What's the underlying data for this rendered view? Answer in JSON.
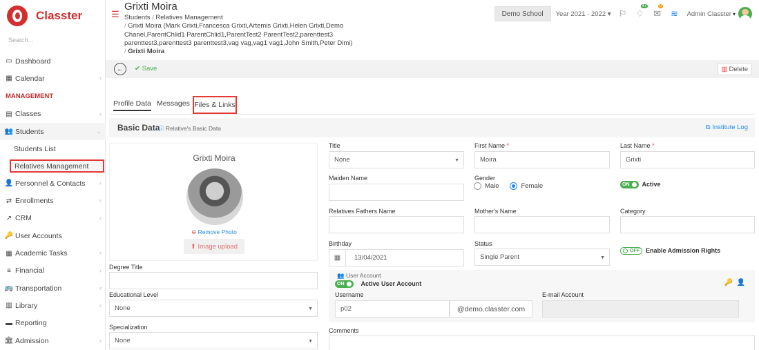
{
  "brand": {
    "name": "Classter"
  },
  "sidebar": {
    "search_placeholder": "Search...",
    "items": [
      {
        "label": "Dashboard",
        "icon": "monitor-icon"
      },
      {
        "label": "Calendar",
        "icon": "calendar-icon"
      }
    ],
    "section_label": "MANAGEMENT",
    "management": [
      {
        "label": "Classes",
        "icon": "classes-icon"
      },
      {
        "label": "Students",
        "icon": "students-icon"
      }
    ],
    "students_sub": [
      "Students List",
      "Relatives Management"
    ],
    "more": [
      {
        "label": "Personnel & Contacts",
        "icon": "personnel-icon"
      },
      {
        "label": "Enrollments",
        "icon": "enrollments-icon"
      },
      {
        "label": "CRM",
        "icon": "crm-icon"
      },
      {
        "label": "User Accounts",
        "icon": "key-icon"
      },
      {
        "label": "Academic Tasks",
        "icon": "tasks-icon"
      },
      {
        "label": "Financial",
        "icon": "money-icon"
      },
      {
        "label": "Transportation",
        "icon": "bus-icon"
      },
      {
        "label": "Library",
        "icon": "library-icon"
      },
      {
        "label": "Reporting",
        "icon": "printer-icon"
      },
      {
        "label": "Admission",
        "icon": "admission-icon"
      }
    ]
  },
  "header": {
    "title": "Grixti Moira",
    "crumb1": "Students",
    "crumb2": "Relatives Management",
    "crumb3": "Grixti Moira (Mark Grixti,Francesca Grixti,Artemis Grixti,Helen Grixti,Demo Chanel,ParentChlid1 ParentChlid1,ParentTest2 ParentTest2,parenttest3 parenttest3,parenttest3 parenttest3,vag vag,vag1 vag1,John Smith,Peter Dimi)",
    "crumb4": "Grixti Moira",
    "school": "Demo School",
    "year": "Year 2021 - 2022",
    "badge_flag": "47",
    "badge_msg": "0",
    "admin": "Admin Classter"
  },
  "toolbar": {
    "save": "Save",
    "delete": "Delete"
  },
  "tabs": {
    "profile": "Profile Data",
    "messages": "Messages",
    "files": "Files & Links"
  },
  "basic": {
    "title": "Basic Data",
    "subtitle": "Relative's Basic Data",
    "institute_log": "Institute Log"
  },
  "profile": {
    "name": "Grixti Moira",
    "remove_photo": "Remove Photo",
    "image_upload": "Image upload"
  },
  "form": {
    "title_label": "Title",
    "title_value": "None",
    "first_name_label": "First Name",
    "first_name_value": "Moira",
    "last_name_label": "Last Name",
    "last_name_value": "Grixti",
    "maiden_label": "Maiden Name",
    "gender_label": "Gender",
    "gender_male": "Male",
    "gender_female": "Female",
    "active_toggle": "ON",
    "active_label": "Active",
    "fathers_label": "Relatives Fathers Name",
    "mothers_label": "Mother's Name",
    "category_label": "Category",
    "birthday_label": "Birthday",
    "birthday_value": "13/04/2021",
    "status_label": "Status",
    "status_value": "Single Parent",
    "admission_toggle": "OFF",
    "admission_label": "Enable Admission Rights",
    "degree_label": "Degree Title",
    "edu_label": "Educational Level",
    "edu_value": "None",
    "spec_label": "Specialization",
    "spec_value": "None",
    "user_account_label": "User Account",
    "active_user_toggle": "ON",
    "active_user_label": "Active User Account",
    "username_label": "Username",
    "username_value": "p02",
    "domain": "@demo.classter.com",
    "email_label": "E-mail Account",
    "comments_label": "Comments"
  }
}
